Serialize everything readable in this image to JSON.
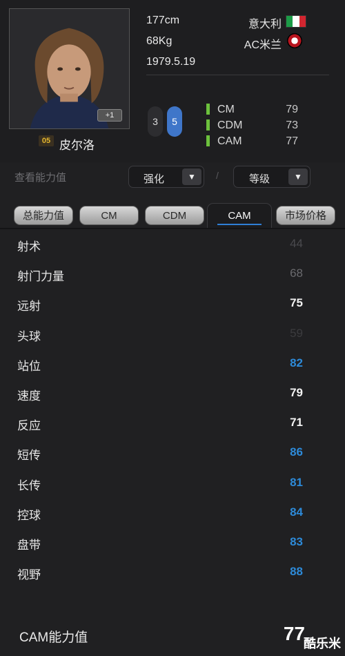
{
  "player": {
    "height": "177cm",
    "weight": "68Kg",
    "birth": "1979.5.19",
    "country": "意大利",
    "club": "AC米兰",
    "season": "05",
    "name": "皮尔洛",
    "plus_badge": "+1",
    "weak_foot_left": "3",
    "weak_foot_right": "5",
    "flag_colors": [
      "#1c9b47",
      "#ffffff",
      "#d22630"
    ],
    "icons": [
      "italy-flag-icon",
      "ac-milan-logo-icon",
      "foot-icon"
    ]
  },
  "positions": [
    {
      "name": "CM",
      "value": "79"
    },
    {
      "name": "CDM",
      "value": "73"
    },
    {
      "name": "CAM",
      "value": "77"
    }
  ],
  "controls": {
    "view_label": "查看能力值",
    "enhance": "强化",
    "level": "等级",
    "separator": "/",
    "dropdown_arrow": "▼"
  },
  "tabs": [
    "总能力值",
    "CM",
    "CDM",
    "CAM",
    "市场价格"
  ],
  "active_tab": "CAM",
  "stats": [
    {
      "name": "射术",
      "value": "44",
      "tone": "dim"
    },
    {
      "name": "射门力量",
      "value": "68",
      "tone": "dim"
    },
    {
      "name": "远射",
      "value": "75",
      "tone": "white"
    },
    {
      "name": "头球",
      "value": "59",
      "tone": "dim2"
    },
    {
      "name": "站位",
      "value": "82",
      "tone": "blue"
    },
    {
      "name": "速度",
      "value": "79",
      "tone": "white"
    },
    {
      "name": "反应",
      "value": "71",
      "tone": "white"
    },
    {
      "name": "短传",
      "value": "86",
      "tone": "blue"
    },
    {
      "name": "长传",
      "value": "81",
      "tone": "blue"
    },
    {
      "name": "控球",
      "value": "84",
      "tone": "blue"
    },
    {
      "name": "盘带",
      "value": "83",
      "tone": "blue"
    },
    {
      "name": "视野",
      "value": "88",
      "tone": "blue"
    }
  ],
  "total": {
    "label": "CAM能力值",
    "value": "77"
  },
  "watermark": "酷乐米",
  "colors": {
    "accent_blue": "#2d8ad8",
    "position_green": "#6cc13d",
    "foot_blue": "#3f76c9"
  }
}
